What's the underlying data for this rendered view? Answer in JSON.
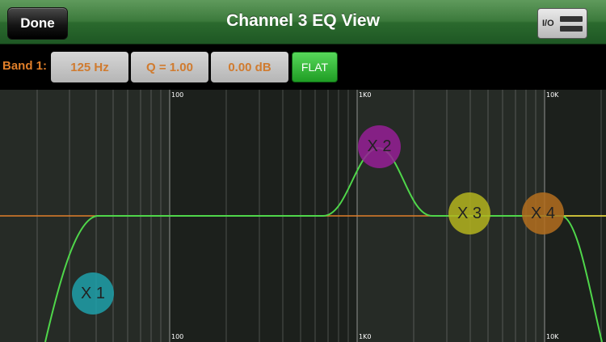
{
  "header": {
    "done_label": "Done",
    "title": "Channel 3 EQ View",
    "io_label": "I/O"
  },
  "band": {
    "label": "Band 1:",
    "frequency": "125 Hz",
    "q": "Q = 1.00",
    "gain": "0.00 dB",
    "flat_label": "FLAT"
  },
  "graph": {
    "freq_labels_top": [
      "100",
      "1K0",
      "10K"
    ],
    "freq_labels_bottom": [
      "100",
      "1K0",
      "10K"
    ],
    "nodes": [
      {
        "label": "X 1",
        "color": "#1ea0aa"
      },
      {
        "label": "X 2",
        "color": "#961e96"
      },
      {
        "label": "X 3",
        "color": "#b4b41e"
      },
      {
        "label": "X 4",
        "color": "#b46e1e"
      }
    ],
    "colors": {
      "curve": "#4fd64a",
      "zero_line": "#e07f2a",
      "band_label": "#e07f2a"
    }
  }
}
